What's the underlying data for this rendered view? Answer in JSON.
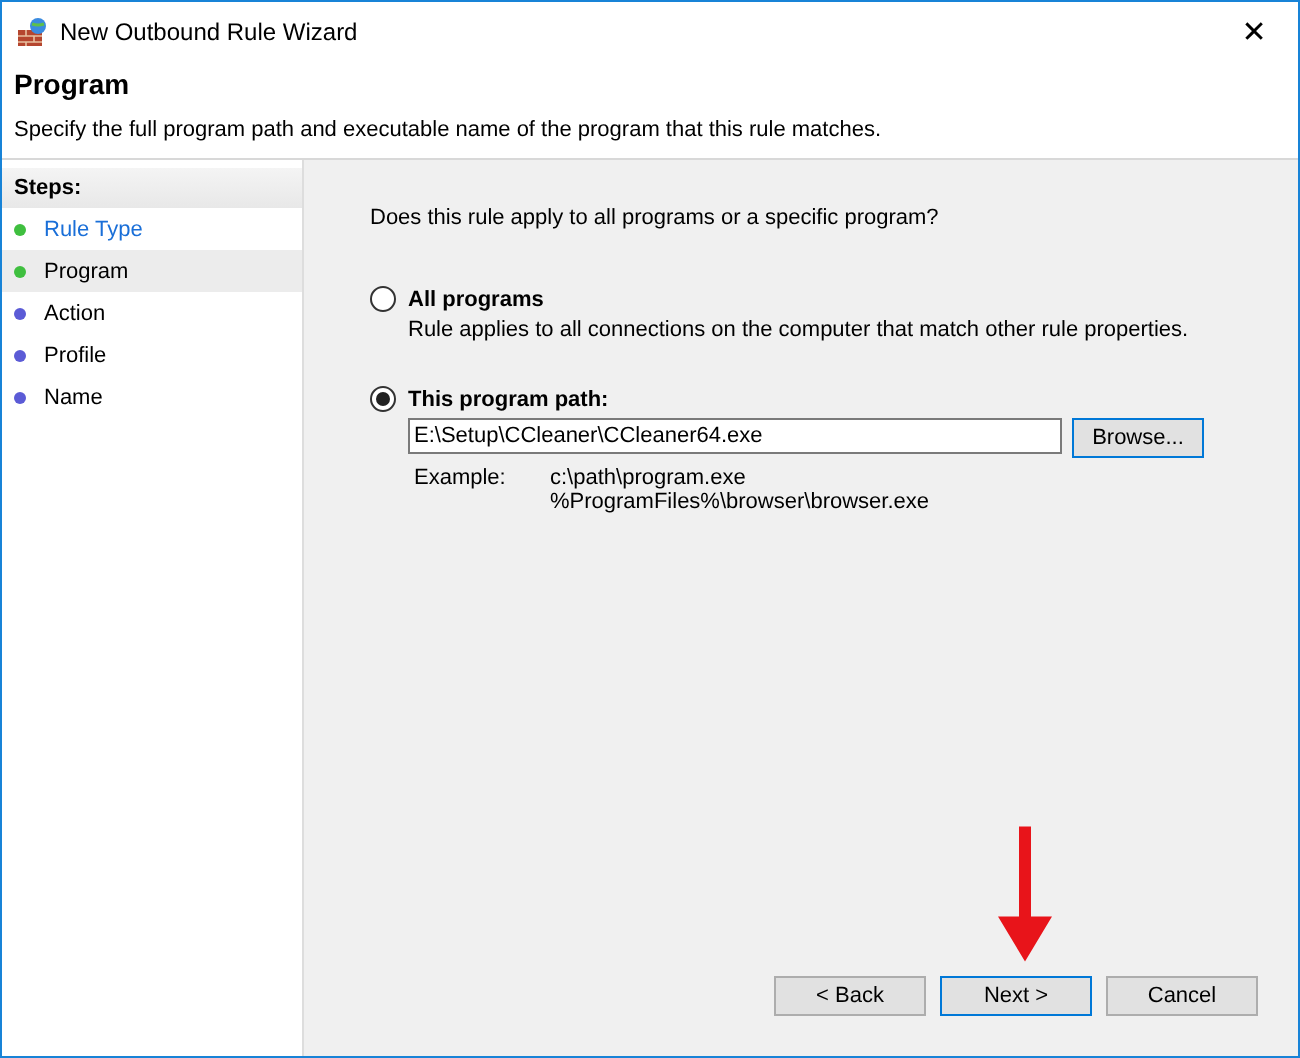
{
  "window": {
    "title": "New Outbound Rule Wizard",
    "close": "✕"
  },
  "header": {
    "title": "Program",
    "description": "Specify the full program path and executable name of the program that this rule matches."
  },
  "steps": {
    "title": "Steps:",
    "items": [
      {
        "label": "Rule Type",
        "selected": false,
        "link": true,
        "color": "#3fbf3f"
      },
      {
        "label": "Program",
        "selected": true,
        "link": false,
        "color": "#3fbf3f"
      },
      {
        "label": "Action",
        "selected": false,
        "link": false,
        "color": "#5b5bd6"
      },
      {
        "label": "Profile",
        "selected": false,
        "link": false,
        "color": "#5b5bd6"
      },
      {
        "label": "Name",
        "selected": false,
        "link": false,
        "color": "#5b5bd6"
      }
    ]
  },
  "question": "Does this rule apply to all programs or a specific program?",
  "options": [
    {
      "label": "All programs",
      "selected": false,
      "description": "Rule applies to all connections on the computer that match other rule properties."
    },
    {
      "label": "This program path:",
      "selected": true,
      "path": "E:\\Setup\\CCleaner\\CCleaner64.exe",
      "browse": "Browse...",
      "example_label": "Example:",
      "examples": [
        "c:\\path\\program.exe",
        "%ProgramFiles%\\browser\\browser.exe"
      ]
    }
  ],
  "buttons": [
    {
      "label": "< Back",
      "focused": false
    },
    {
      "label": "Next >",
      "focused": true
    },
    {
      "label": "Cancel",
      "focused": false
    }
  ]
}
